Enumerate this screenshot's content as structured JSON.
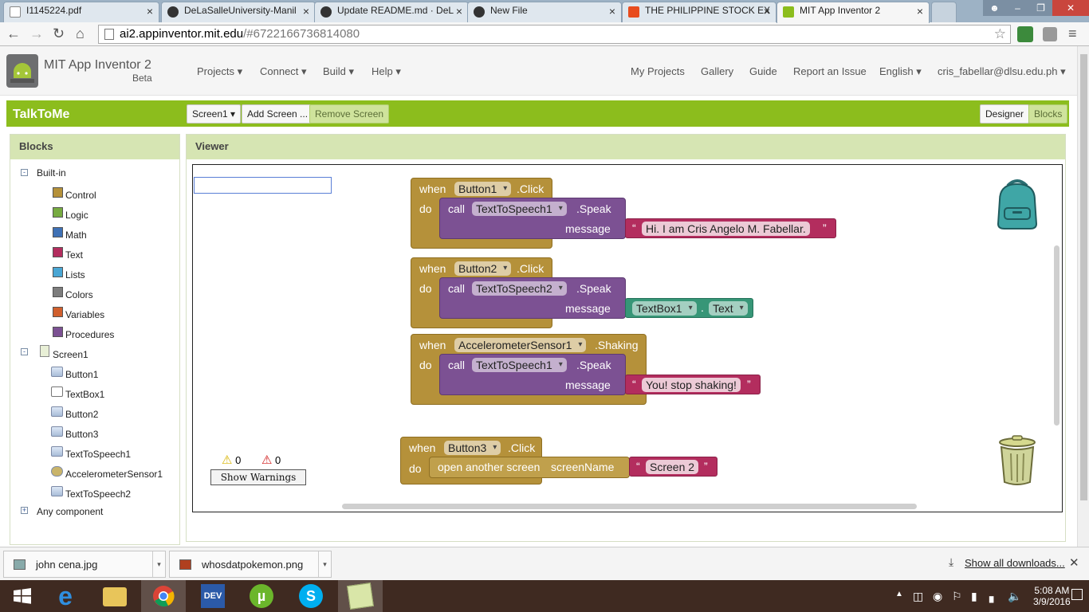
{
  "browser": {
    "tabs": [
      {
        "title": "I1145224.pdf",
        "icon": "document-icon",
        "color": "#ffffff"
      },
      {
        "title": "DeLaSalleUniversity-Manil",
        "icon": "github-icon",
        "color": "#333333"
      },
      {
        "title": "Update README.md · DeL",
        "icon": "github-icon",
        "color": "#333333"
      },
      {
        "title": "New File",
        "icon": "github-icon",
        "color": "#333333"
      },
      {
        "title": "THE PHILIPPINE STOCK EX",
        "icon": "pse-icon",
        "color": "#e84c1e"
      },
      {
        "title": "MIT App Inventor 2",
        "icon": "appinventor-icon",
        "color": "#8cbd1d"
      }
    ],
    "url_host": "ai2.appinventor.mit.edu",
    "url_path": "/#6722166736814080"
  },
  "app": {
    "brand": "MIT App Inventor 2",
    "beta": "Beta",
    "menus_left": [
      "Projects ▾",
      "Connect ▾",
      "Build ▾",
      "Help ▾"
    ],
    "menus_right": [
      "My Projects",
      "Gallery",
      "Guide",
      "Report an Issue",
      "English ▾",
      "cris_fabellar@dlsu.edu.ph ▾"
    ],
    "project_name": "TalkToMe",
    "screen_select": "Screen1 ▾",
    "add_screen": "Add Screen ...",
    "remove_screen": "Remove Screen",
    "designer": "Designer",
    "blocks": "Blocks",
    "colors": {
      "accent": "#8cbd1d",
      "panel_head": "#d6e5b3"
    }
  },
  "blocks_panel": {
    "title": "Blocks",
    "builtin_label": "Built-in",
    "builtin": [
      {
        "label": "Control",
        "color": "#b5913a"
      },
      {
        "label": "Logic",
        "color": "#77ab41"
      },
      {
        "label": "Math",
        "color": "#3f71b5"
      },
      {
        "label": "Text",
        "color": "#b32d5e"
      },
      {
        "label": "Lists",
        "color": "#49a6d4"
      },
      {
        "label": "Colors",
        "color": "#7d7d7d"
      },
      {
        "label": "Variables",
        "color": "#d05f2d"
      },
      {
        "label": "Procedures",
        "color": "#7c5193"
      }
    ],
    "screen_label": "Screen1",
    "components": [
      "Button1",
      "TextBox1",
      "Button2",
      "Button3",
      "TextToSpeech1",
      "AccelerometerSensor1",
      "TextToSpeech2"
    ],
    "any_component": "Any component"
  },
  "viewer": {
    "title": "Viewer",
    "kw": {
      "when": "when",
      "do": "do",
      "call": "call",
      "message": "message",
      "open": "open another screen",
      "screenName": "screenName"
    },
    "b1": {
      "comp": "Button1",
      "event": ".Click",
      "tts": "TextToSpeech1",
      "method": ".Speak",
      "msg": "Hi. I am Cris Angelo M. Fabellar."
    },
    "b2": {
      "comp": "Button2",
      "event": ".Click",
      "tts": "TextToSpeech2",
      "method": ".Speak",
      "tb": "TextBox1",
      "prop": "Text"
    },
    "b3": {
      "comp": "AccelerometerSensor1",
      "event": ".Shaking",
      "tts": "TextToSpeech1",
      "method": ".Speak",
      "msg": "You! stop shaking!"
    },
    "b4": {
      "comp": "Button3",
      "event": ".Click",
      "screen": "Screen 2"
    },
    "warnings": "0",
    "errors": "0",
    "show_warnings": "Show Warnings"
  },
  "downloads": {
    "items": [
      "john cena.jpg",
      "whosdatpokemon.png"
    ],
    "show_all": "Show all downloads..."
  },
  "taskbar": {
    "time": "5:08 AM",
    "date": "3/9/2016"
  }
}
